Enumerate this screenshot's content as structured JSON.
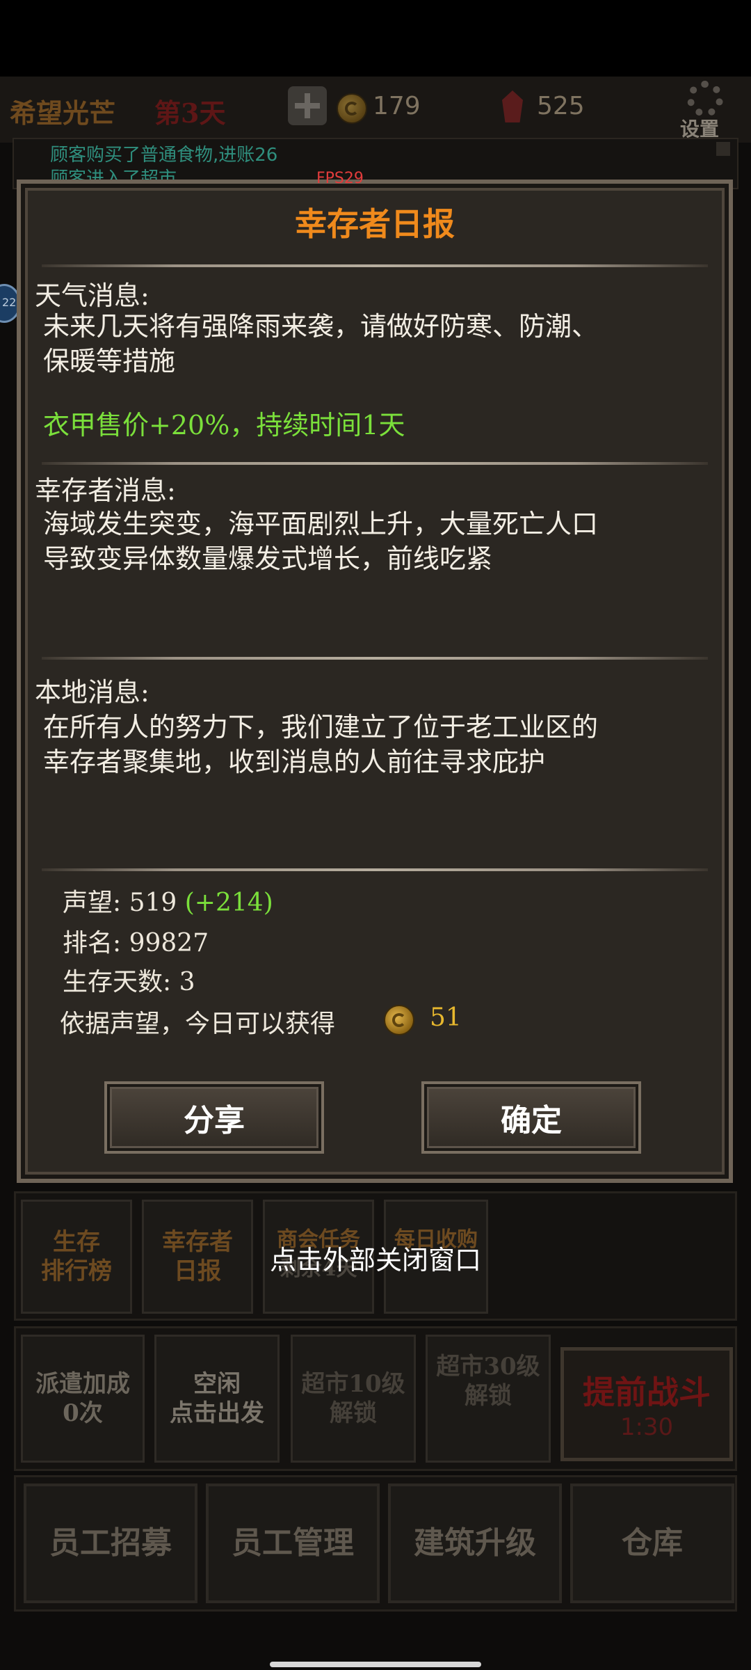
{
  "hud": {
    "title": "希望光芒",
    "day": "第3天",
    "coins": "179",
    "gems": "525",
    "settings_label": "设置"
  },
  "log": {
    "line1": "顾客购买了普通食物,进账26",
    "line2": "顾客进入了超市"
  },
  "fps": "FPS29",
  "side_badge": "22",
  "dialog": {
    "title": "幸存者日报",
    "weather_head": "天气消息:",
    "weather_line1": "未来几天将有强降雨来袭，请做好防寒、防潮、",
    "weather_line2": "保暖等措施",
    "weather_effect": "衣甲售价+20%，持续时间1天",
    "survivor_head": "幸存者消息:",
    "survivor_line1": "海域发生突变，海平面剧烈上升，大量死亡人口",
    "survivor_line2": "导致变异体数量爆发式增长，前线吃紧",
    "local_head": "本地消息:",
    "local_line1": "在所有人的努力下，我们建立了位于老工业区的",
    "local_line2": "幸存者聚集地，收到消息的人前往寻求庇护",
    "reputation_label": "声望:",
    "reputation_value": "519",
    "reputation_delta": "(+214)",
    "rank_label": "排名:",
    "rank_value": "99827",
    "days_label": "生存天数:",
    "days_value": "3",
    "reward_label": "依据声望，今日可以获得",
    "reward_value": "51",
    "share_button": "分享",
    "confirm_button": "确定"
  },
  "close_hint": "点击外部关闭窗口",
  "menu_row1": {
    "ranking_l1": "生存",
    "ranking_l2": "排行榜",
    "daily_l1": "幸存者",
    "daily_l2": "日报",
    "guild_l1": "商会任务",
    "guild_l2": "剩余4天",
    "income_l1": "每日收购"
  },
  "menu_row2": {
    "dispatch_l1": "派遣加成",
    "dispatch_l2": "0次",
    "idle_l1": "空闲",
    "idle_l2": "点击出发",
    "lock10_l1": "超市10级",
    "lock10_l2": "解锁",
    "lock30_l1": "超市30级",
    "lock30_l2": "解锁",
    "battle_label": "提前战斗",
    "battle_timer": "1:30"
  },
  "bottom_nav": {
    "recruit": "员工招募",
    "manage": "员工管理",
    "upgrade": "建筑升级",
    "warehouse": "仓库"
  },
  "colors": {
    "accent_orange": "#f08a1c",
    "positive_green": "#7be03b",
    "coin_gold": "#e8b82e"
  }
}
